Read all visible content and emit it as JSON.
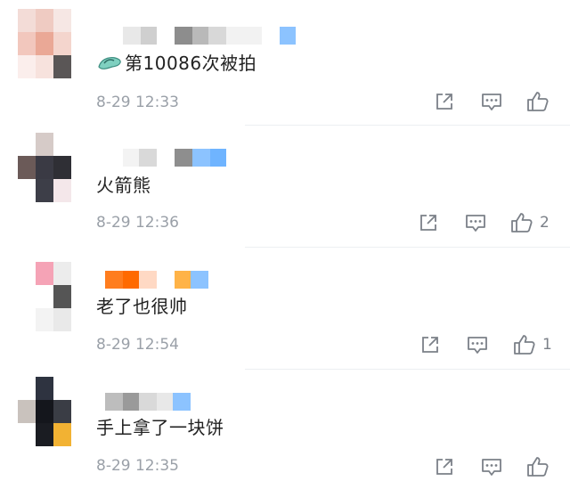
{
  "comments": [
    {
      "text": "第10086次被拍",
      "emoji": "slipper-emoji",
      "time": "8-29 12:33",
      "like_count": ""
    },
    {
      "text": "火箭熊",
      "time": "8-29 12:36",
      "like_count": "2"
    },
    {
      "text": "老了也很帅",
      "time": "8-29 12:54",
      "like_count": "1"
    },
    {
      "text": "手上拿了一块饼",
      "time": "8-29 12:35",
      "like_count": ""
    }
  ],
  "icons": {
    "share": "share-icon",
    "reply": "comment-icon",
    "like": "thumbs-up-icon"
  },
  "colors": {
    "text": "#222222",
    "time": "#9aa0a8",
    "icon": "#7b8088",
    "divider": "#eceff2",
    "name_blur_blue": "#6fb4ff",
    "name_blur_orange": "#ff7d1e"
  }
}
